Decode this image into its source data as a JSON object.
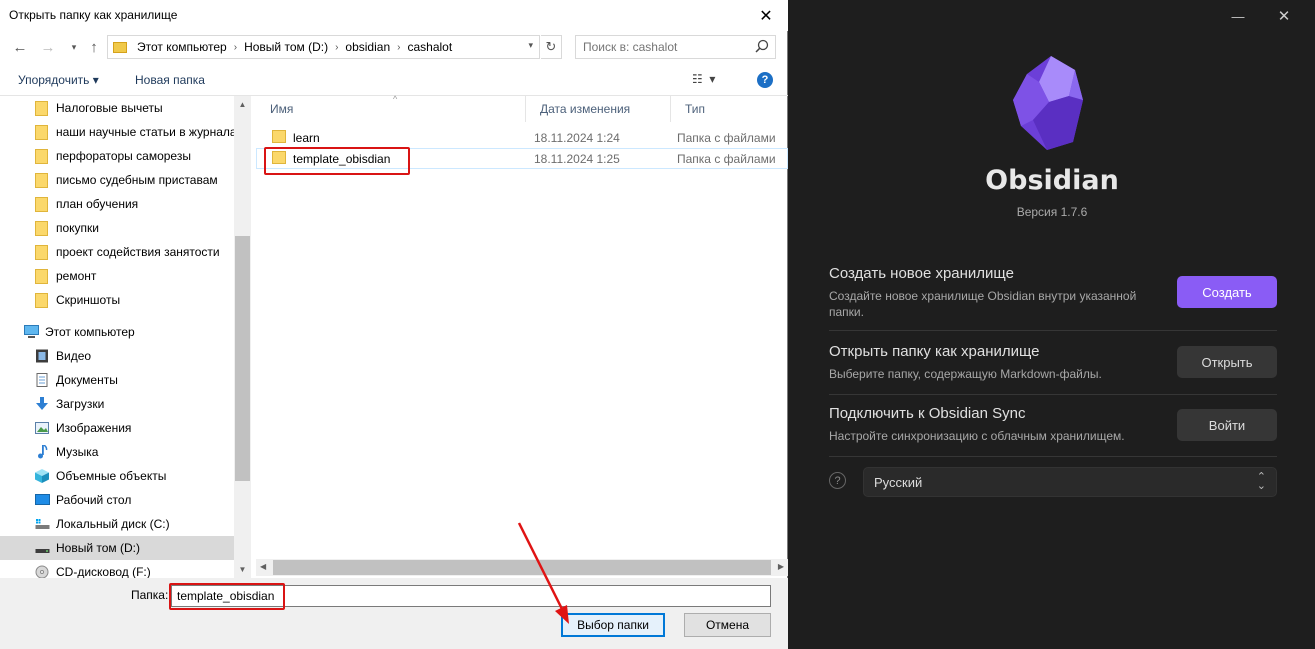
{
  "dialog": {
    "title": "Открыть папку как хранилище",
    "breadcrumb": [
      "Этот компьютер",
      "Новый том (D:)",
      "obsidian",
      "cashalot"
    ],
    "search_placeholder": "Поиск в: cashalot",
    "toolbar": {
      "organize": "Упорядочить ▾",
      "new_folder": "Новая папка",
      "help": "?"
    },
    "nav_items": [
      {
        "label": "Налоговые вычеты",
        "icon": "folder-icon"
      },
      {
        "label": "наши научные статьи в журнала",
        "icon": "folder-icon"
      },
      {
        "label": "перфораторы саморезы",
        "icon": "folder-icon"
      },
      {
        "label": "письмо судебным приставам",
        "icon": "folder-icon"
      },
      {
        "label": "план обучения",
        "icon": "folder-icon"
      },
      {
        "label": "покупки",
        "icon": "folder-icon"
      },
      {
        "label": "проект содействия занятости",
        "icon": "folder-icon"
      },
      {
        "label": "ремонт",
        "icon": "folder-icon"
      },
      {
        "label": "Скриншоты",
        "icon": "folder-icon"
      },
      {
        "label": "Этот компьютер",
        "icon": "computer-icon"
      },
      {
        "label": "Видео",
        "icon": "video-icon"
      },
      {
        "label": "Документы",
        "icon": "documents-icon"
      },
      {
        "label": "Загрузки",
        "icon": "downloads-icon"
      },
      {
        "label": "Изображения",
        "icon": "pictures-icon"
      },
      {
        "label": "Музыка",
        "icon": "music-icon"
      },
      {
        "label": "Объемные объекты",
        "icon": "3d-objects-icon"
      },
      {
        "label": "Рабочий стол",
        "icon": "desktop-icon"
      },
      {
        "label": "Локальный диск (C:)",
        "icon": "drive-icon"
      },
      {
        "label": "Новый том (D:)",
        "icon": "drive-icon"
      },
      {
        "label": "CD-дисковод (F:)",
        "icon": "cd-drive-icon"
      }
    ],
    "columns": {
      "name": "Имя",
      "modified": "Дата изменения",
      "type": "Тип"
    },
    "files": [
      {
        "name": "learn",
        "modified": "18.11.2024 1:24",
        "type": "Папка с файлами"
      },
      {
        "name": "template_obisdian",
        "modified": "18.11.2024 1:25",
        "type": "Папка с файлами"
      }
    ],
    "folder_label": "Папка:",
    "folder_value": "template_obisdian",
    "select_button": "Выбор папки",
    "cancel_button": "Отмена"
  },
  "obsidian": {
    "app_name": "Obsidian",
    "version": "Версия 1.7.6",
    "accent_color": "#8a5cf5",
    "actions": [
      {
        "title": "Создать новое хранилище",
        "desc": "Создайте новое хранилище Obsidian внутри указанной папки.",
        "button": "Создать"
      },
      {
        "title": "Открыть папку как хранилище",
        "desc": "Выберите папку, содержащую Markdown-файлы.",
        "button": "Открыть"
      },
      {
        "title": "Подключить к Obsidian Sync",
        "desc": "Настройте синхронизацию с облачным хранилищем.",
        "button": "Войти"
      }
    ],
    "language": "Русский"
  }
}
